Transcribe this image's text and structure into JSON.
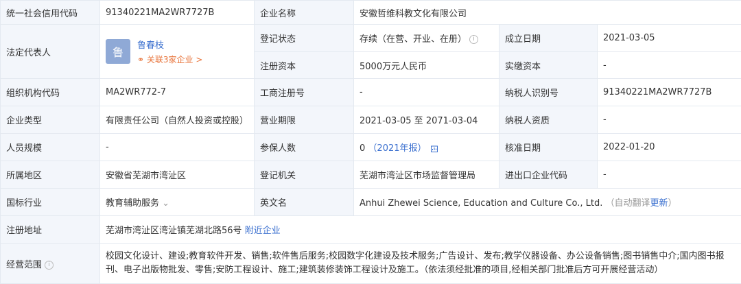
{
  "rows": {
    "credit_code": {
      "label": "统一社会信用代码",
      "value": "91340221MA2WR7727B"
    },
    "company_name": {
      "label": "企业名称",
      "value": "安徽哲维科教文化有限公司"
    },
    "legal_rep": {
      "label": "法定代表人",
      "avatar_char": "鲁",
      "name": "鲁春枝",
      "related": "关联3家企业 >"
    },
    "reg_status": {
      "label": "登记状态",
      "value": "存续（在营、开业、在册）"
    },
    "founded": {
      "label": "成立日期",
      "value": "2021-03-05"
    },
    "reg_capital": {
      "label": "注册资本",
      "value": "5000万元人民币"
    },
    "paid_capital": {
      "label": "实缴资本",
      "value": "-"
    },
    "org_code": {
      "label": "组织机构代码",
      "value": "MA2WR772-7"
    },
    "biz_reg_no": {
      "label": "工商注册号",
      "value": "-"
    },
    "tax_id": {
      "label": "纳税人识别号",
      "value": "91340221MA2WR7727B"
    },
    "company_type": {
      "label": "企业类型",
      "value": "有限责任公司（自然人投资或控股）"
    },
    "biz_term": {
      "label": "营业期限",
      "value": "2021-03-05 至 2071-03-04"
    },
    "taxpayer_qual": {
      "label": "纳税人资质",
      "value": "-"
    },
    "staff_size": {
      "label": "人员规模",
      "value": "-"
    },
    "insured": {
      "label": "参保人数",
      "value": "0",
      "report": "（2021年报）"
    },
    "approve_date": {
      "label": "核准日期",
      "value": "2022-01-20"
    },
    "region": {
      "label": "所属地区",
      "value": "安徽省芜湖市湾沚区"
    },
    "reg_authority": {
      "label": "登记机关",
      "value": "芜湖市湾沚区市场监督管理局"
    },
    "import_export": {
      "label": "进出口企业代码",
      "value": "-"
    },
    "industry": {
      "label": "国标行业",
      "value": "教育辅助服务"
    },
    "english_name": {
      "label": "英文名",
      "value": "Anhui Zhewei Science, Education and Culture Co., Ltd.",
      "auto_pre": "（自动翻译",
      "auto_link": "更新",
      "auto_post": "）"
    },
    "address": {
      "label": "注册地址",
      "value": "芜湖市湾沚区湾沚镇芜湖北路56号",
      "nearby": "附近企业"
    },
    "scope": {
      "label": "经营范围",
      "value": "校园文化设计、建设;教育软件开发、销售;软件售后服务;校园数字化建设及技术服务;广告设计、发布;教学仪器设备、办公设备销售;图书销售中介;国内图书报刊、电子出版物批发、零售;安防工程设计、施工;建筑装修装饰工程设计及施工。（依法须经批准的项目,经相关部门批准后方可开展经营活动）"
    }
  },
  "icons": {
    "info": "info-circle-icon",
    "chart": "chart-icon",
    "chevron": "chevron-down-icon",
    "link": "link-icon"
  }
}
